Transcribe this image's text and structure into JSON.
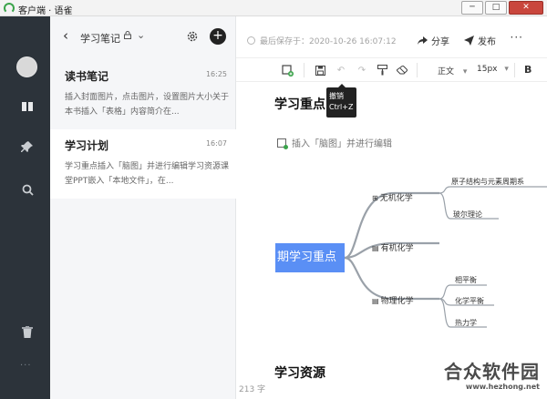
{
  "window": {
    "title": "客户端 · 语雀",
    "controls": [
      "─",
      "□",
      "✕"
    ]
  },
  "notebook": {
    "title": "学习笔记",
    "lock_icon": "lock-icon",
    "caret": "⌄",
    "add": "+"
  },
  "notes": [
    {
      "title": "读书笔记",
      "date": "16:25",
      "preview": "插入封面图片，点击图片，设置图片大小关于本书插入「表格」内容简介在..."
    },
    {
      "title": "学习计划",
      "date": "16:07",
      "preview": "学习重点插入「脑图」并进行编辑学习资源课堂PPT嵌入「本地文件」，在..."
    }
  ],
  "editor": {
    "saved_text": "最后保存于：2020-10-26 16:07:12",
    "share_label": "分享",
    "publish_label": "发布",
    "more": "···",
    "toolbar": {
      "text_style": "正文",
      "font_size": "15px",
      "bold": "B"
    },
    "tooltip": {
      "label": "撤销",
      "shortcut": "Ctrl+Z"
    },
    "heading1": "学习重点",
    "insert_hint": "插入「脑图」并进行编辑",
    "heading2": "学习资源",
    "word_count": "213 字"
  },
  "mindmap": {
    "root": "期学习重点",
    "branches": [
      {
        "label": "无机化学",
        "children": [
          "原子结构与元素周期系",
          "玻尔理论"
        ]
      },
      {
        "label": "有机化学",
        "children": []
      },
      {
        "label": "物理化学",
        "children": [
          "相平衡",
          "化学平衡",
          "热力学"
        ]
      }
    ],
    "colors": {
      "root": "#5a8ff5",
      "lines": "#9aa1a9"
    }
  },
  "watermark": {
    "title": "合众软件园",
    "url": "www.hezhong.net"
  },
  "colors": {
    "rail": "#2c333a",
    "list_bg": "#f5f6f8",
    "accent_green": "#3aa34a"
  }
}
